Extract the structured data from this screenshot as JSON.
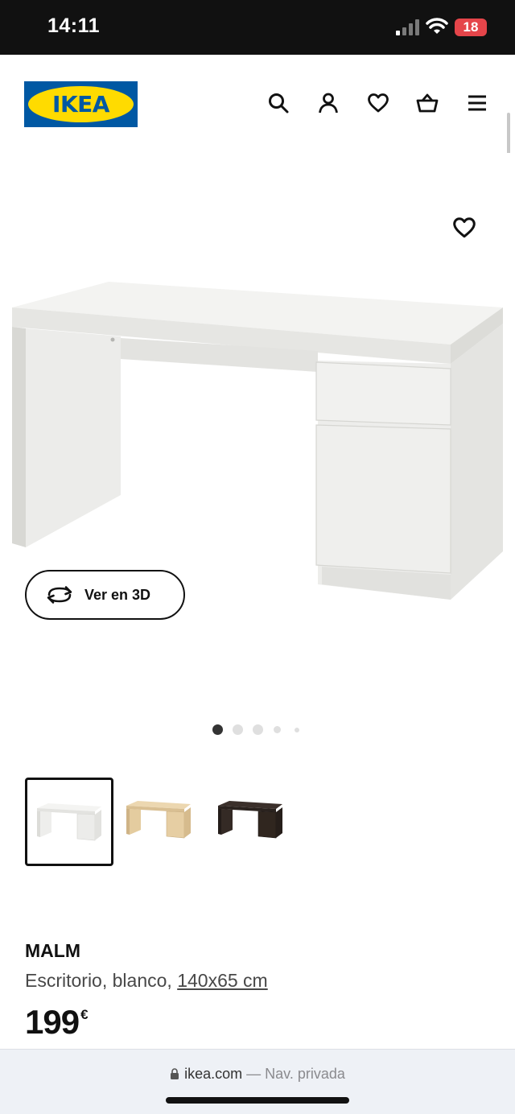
{
  "status_bar": {
    "time": "14:11",
    "battery_level": "18",
    "battery_color": "#e5454a"
  },
  "header": {
    "logo_text": "IKEA",
    "logo_colors": {
      "blue": "#0058a3",
      "yellow": "#ffdb00"
    },
    "icons": [
      "search-icon",
      "account-icon",
      "heart-icon",
      "cart-icon",
      "menu-icon"
    ]
  },
  "product_stage": {
    "favorite_icon": "heart-icon",
    "view_3d_label": "Ver en 3D",
    "view_3d_icon": "rotate-icon",
    "image_count": 5,
    "active_image_index": 0
  },
  "variants": [
    {
      "color": "white",
      "selected": true
    },
    {
      "color": "birch",
      "selected": false
    },
    {
      "color": "black-brown",
      "selected": false
    }
  ],
  "product": {
    "name": "MALM",
    "description": "Escritorio, blanco,",
    "size": "140x65 cm",
    "price_integer": "199",
    "price_currency": "€"
  },
  "browser": {
    "host": "ikea.com",
    "separator": "—",
    "mode": "Nav. privada"
  }
}
